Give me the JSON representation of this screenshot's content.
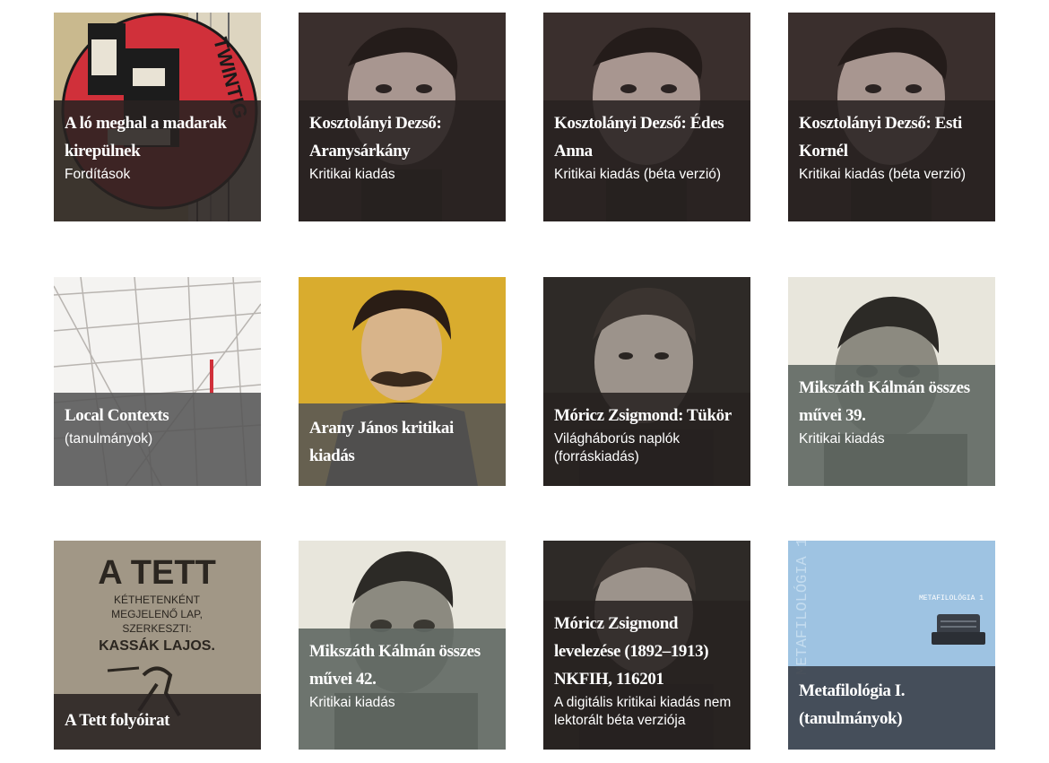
{
  "tiles": [
    {
      "title": "A ló meghal a madarak kirepülnek",
      "subtitle": "Fordítások",
      "image": "twintig-collage-image"
    },
    {
      "title": "Kosztolányi Dezső: Aranysárkány",
      "subtitle": "Kritikai kiadás",
      "image": "kosztolanyi-portrait-image"
    },
    {
      "title": "Kosztolányi Dezső: Édes Anna",
      "subtitle": "Kritikai kiadás (béta verzió)",
      "image": "kosztolanyi-portrait-image"
    },
    {
      "title": "Kosztolányi Dezső: Esti Kornél",
      "subtitle": "Kritikai kiadás (béta verzió)",
      "image": "kosztolanyi-portrait-image"
    },
    {
      "title": "Local Contexts",
      "subtitle": "(tanulmányok)",
      "image": "grid-lines-image"
    },
    {
      "title": "Arany János kritikai kiadás",
      "subtitle": "",
      "image": "arany-janos-portrait-image"
    },
    {
      "title": "Móricz Zsigmond: Tükör",
      "subtitle": "Világháborús naplók (forráskiadás)",
      "image": "moricz-portrait-image"
    },
    {
      "title": "Mikszáth Kálmán összes művei 39.",
      "subtitle": "Kritikai kiadás",
      "image": "mikszath-portrait-image"
    },
    {
      "title": "A Tett folyóirat",
      "subtitle": "",
      "image": "a-tett-cover-image",
      "cover_text": {
        "headline": "A TETT",
        "line1": "KÉTHETENKÉNT",
        "line2": "MEGJELENŐ LAP,",
        "line3": "SZERKESZTI:",
        "line4": "KASSÁK LAJOS."
      }
    },
    {
      "title": "Mikszáth Kálmán összes művei 42.",
      "subtitle": "Kritikai kiadás",
      "image": "mikszath-portrait-image"
    },
    {
      "title": "Móricz Zsigmond levelezése (1892–1913) NKFIH, 116201",
      "subtitle": "A digitális kritikai kiadás nem lektorált béta verziója",
      "image": "moricz-portrait-image"
    },
    {
      "title": "Metafilológia I. (tanulmányok)",
      "subtitle": "",
      "image": "metafilologia-cover-image",
      "cover_text": {
        "spine": "METAFILOLÓGIA 1",
        "label": "METAFILOLÓGIA 1"
      }
    }
  ],
  "colors": {
    "caption_dark": "#282221",
    "caption_grey": "#555555",
    "caption_slate": "#3e444e",
    "metafilologia_blue": "#9ec3e2",
    "twintig_red": "#d0303a",
    "arany_gold": "#e2b830"
  }
}
